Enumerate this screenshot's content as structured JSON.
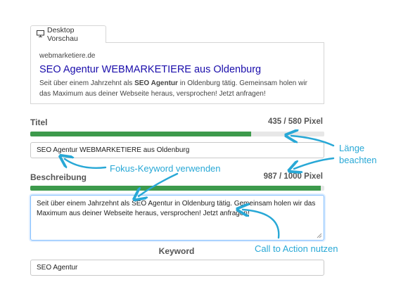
{
  "preview": {
    "tab_label": "Desktop Vorschau",
    "tab_icon": "monitor-icon",
    "url": "webmarketiere.de",
    "title": "SEO Agentur WEBMARKETIERE aus Oldenburg",
    "desc_pre": "Seit über einem Jahrzehnt als ",
    "desc_bold": "SEO Agentur",
    "desc_post": " in Oldenburg tätig. Gemeinsam holen wir das Maximum aus deiner Webseite heraus, versprochen! Jetzt anfragen!"
  },
  "title_section": {
    "label": "Titel",
    "count": "435 / 580 Pixel",
    "progress": 0.75,
    "value": "SEO Agentur WEBMARKETIERE aus Oldenburg"
  },
  "description_section": {
    "label": "Beschreibung",
    "count": "987 / 1000 Pixel",
    "progress": 0.987,
    "value": "Seit über einem Jahrzehnt als SEO Agentur in Oldenburg tätig. Gemeinsam holen wir das Maximum aus deiner Webseite heraus, versprochen! Jetzt anfragen!"
  },
  "keyword_section": {
    "label": "Keyword",
    "value": "SEO Agentur"
  },
  "annotations": {
    "laenge_line1": "Länge",
    "laenge_line2": "beachten",
    "fokus": "Fokus-Keyword verwenden",
    "cta": "Call to Action nutzen"
  },
  "colors": {
    "progress": "#3d9a4c",
    "annotation": "#28a8d6",
    "preview_title": "#1a0dab"
  }
}
